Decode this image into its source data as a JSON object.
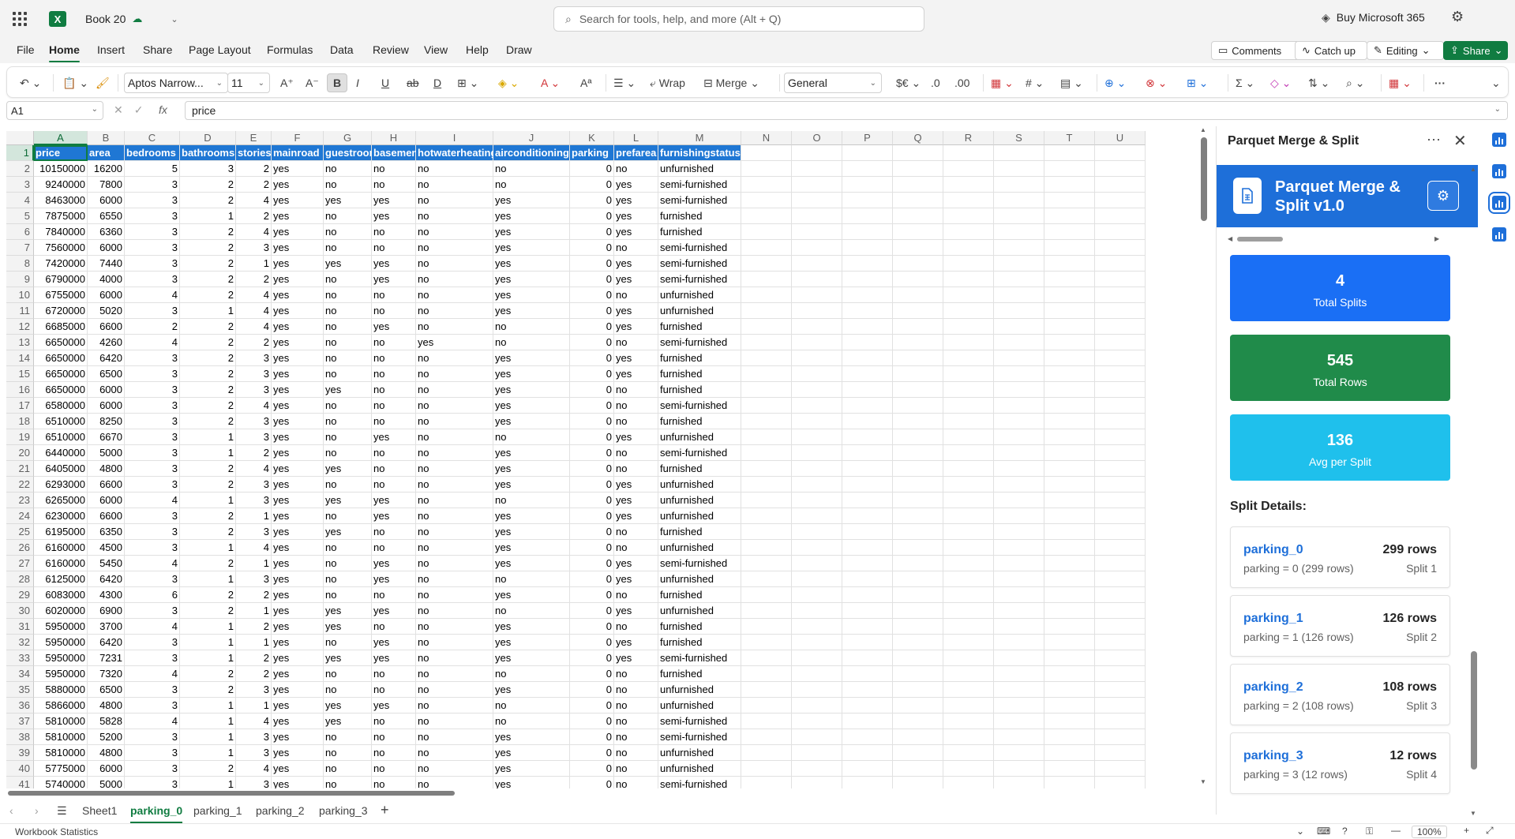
{
  "window": {
    "app_icon": "excel-logo",
    "doc_title": "Book 20",
    "search_placeholder": "Search for tools, help, and more (Alt + Q)",
    "buy": "Buy Microsoft 365"
  },
  "menus": [
    "File",
    "Home",
    "Insert",
    "Share",
    "Page Layout",
    "Formulas",
    "Data",
    "Review",
    "View",
    "Help",
    "Draw"
  ],
  "menu_active": "Home",
  "menu_buttons": {
    "comments": "Comments",
    "catchup": "Catch up",
    "editing": "Editing",
    "share": "Share"
  },
  "ribbon": {
    "font_name": "Aptos Narrow...",
    "font_size": "11",
    "wrap": "Wrap",
    "merge": "Merge",
    "number_format": "General"
  },
  "formula_bar": {
    "name_box": "A1",
    "fx": "fx",
    "content": "price"
  },
  "columns": [
    "A",
    "B",
    "C",
    "D",
    "E",
    "F",
    "G",
    "H",
    "I",
    "J",
    "K",
    "L",
    "M",
    "N",
    "O",
    "P",
    "Q",
    "R",
    "S",
    "T",
    "U"
  ],
  "header_row": [
    "price",
    "area",
    "bedrooms",
    "bathrooms",
    "stories",
    "mainroad",
    "guestroom",
    "basement",
    "hotwaterheating",
    "airconditioning",
    "parking",
    "prefarea",
    "furnishingstatus"
  ],
  "rows": [
    [
      "10150000",
      "16200",
      "5",
      "3",
      "2",
      "yes",
      "no",
      "no",
      "no",
      "no",
      "0",
      "no",
      "unfurnished"
    ],
    [
      "9240000",
      "7800",
      "3",
      "2",
      "2",
      "yes",
      "no",
      "no",
      "no",
      "no",
      "0",
      "yes",
      "semi-furnished"
    ],
    [
      "8463000",
      "6000",
      "3",
      "2",
      "4",
      "yes",
      "yes",
      "yes",
      "no",
      "yes",
      "0",
      "yes",
      "semi-furnished"
    ],
    [
      "7875000",
      "6550",
      "3",
      "1",
      "2",
      "yes",
      "no",
      "yes",
      "no",
      "yes",
      "0",
      "yes",
      "furnished"
    ],
    [
      "7840000",
      "6360",
      "3",
      "2",
      "4",
      "yes",
      "no",
      "no",
      "no",
      "yes",
      "0",
      "yes",
      "furnished"
    ],
    [
      "7560000",
      "6000",
      "3",
      "2",
      "3",
      "yes",
      "no",
      "no",
      "no",
      "yes",
      "0",
      "no",
      "semi-furnished"
    ],
    [
      "7420000",
      "7440",
      "3",
      "2",
      "1",
      "yes",
      "yes",
      "yes",
      "no",
      "yes",
      "0",
      "yes",
      "semi-furnished"
    ],
    [
      "6790000",
      "4000",
      "3",
      "2",
      "2",
      "yes",
      "no",
      "yes",
      "no",
      "yes",
      "0",
      "yes",
      "semi-furnished"
    ],
    [
      "6755000",
      "6000",
      "4",
      "2",
      "4",
      "yes",
      "no",
      "no",
      "no",
      "yes",
      "0",
      "no",
      "unfurnished"
    ],
    [
      "6720000",
      "5020",
      "3",
      "1",
      "4",
      "yes",
      "no",
      "no",
      "no",
      "yes",
      "0",
      "yes",
      "unfurnished"
    ],
    [
      "6685000",
      "6600",
      "2",
      "2",
      "4",
      "yes",
      "no",
      "yes",
      "no",
      "no",
      "0",
      "yes",
      "furnished"
    ],
    [
      "6650000",
      "4260",
      "4",
      "2",
      "2",
      "yes",
      "no",
      "no",
      "yes",
      "no",
      "0",
      "no",
      "semi-furnished"
    ],
    [
      "6650000",
      "6420",
      "3",
      "2",
      "3",
      "yes",
      "no",
      "no",
      "no",
      "yes",
      "0",
      "yes",
      "furnished"
    ],
    [
      "6650000",
      "6500",
      "3",
      "2",
      "3",
      "yes",
      "no",
      "no",
      "no",
      "yes",
      "0",
      "yes",
      "furnished"
    ],
    [
      "6650000",
      "6000",
      "3",
      "2",
      "3",
      "yes",
      "yes",
      "no",
      "no",
      "yes",
      "0",
      "no",
      "furnished"
    ],
    [
      "6580000",
      "6000",
      "3",
      "2",
      "4",
      "yes",
      "no",
      "no",
      "no",
      "yes",
      "0",
      "no",
      "semi-furnished"
    ],
    [
      "6510000",
      "8250",
      "3",
      "2",
      "3",
      "yes",
      "no",
      "no",
      "no",
      "yes",
      "0",
      "no",
      "furnished"
    ],
    [
      "6510000",
      "6670",
      "3",
      "1",
      "3",
      "yes",
      "no",
      "yes",
      "no",
      "no",
      "0",
      "yes",
      "unfurnished"
    ],
    [
      "6440000",
      "5000",
      "3",
      "1",
      "2",
      "yes",
      "no",
      "no",
      "no",
      "yes",
      "0",
      "no",
      "semi-furnished"
    ],
    [
      "6405000",
      "4800",
      "3",
      "2",
      "4",
      "yes",
      "yes",
      "no",
      "no",
      "yes",
      "0",
      "no",
      "furnished"
    ],
    [
      "6293000",
      "6600",
      "3",
      "2",
      "3",
      "yes",
      "no",
      "no",
      "no",
      "yes",
      "0",
      "yes",
      "unfurnished"
    ],
    [
      "6265000",
      "6000",
      "4",
      "1",
      "3",
      "yes",
      "yes",
      "yes",
      "no",
      "no",
      "0",
      "yes",
      "unfurnished"
    ],
    [
      "6230000",
      "6600",
      "3",
      "2",
      "1",
      "yes",
      "no",
      "yes",
      "no",
      "yes",
      "0",
      "yes",
      "unfurnished"
    ],
    [
      "6195000",
      "6350",
      "3",
      "2",
      "3",
      "yes",
      "yes",
      "no",
      "no",
      "yes",
      "0",
      "no",
      "furnished"
    ],
    [
      "6160000",
      "4500",
      "3",
      "1",
      "4",
      "yes",
      "no",
      "no",
      "no",
      "yes",
      "0",
      "no",
      "unfurnished"
    ],
    [
      "6160000",
      "5450",
      "4",
      "2",
      "1",
      "yes",
      "no",
      "yes",
      "no",
      "yes",
      "0",
      "yes",
      "semi-furnished"
    ],
    [
      "6125000",
      "6420",
      "3",
      "1",
      "3",
      "yes",
      "no",
      "yes",
      "no",
      "no",
      "0",
      "yes",
      "unfurnished"
    ],
    [
      "6083000",
      "4300",
      "6",
      "2",
      "2",
      "yes",
      "no",
      "no",
      "no",
      "yes",
      "0",
      "no",
      "furnished"
    ],
    [
      "6020000",
      "6900",
      "3",
      "2",
      "1",
      "yes",
      "yes",
      "yes",
      "no",
      "no",
      "0",
      "yes",
      "unfurnished"
    ],
    [
      "5950000",
      "3700",
      "4",
      "1",
      "2",
      "yes",
      "yes",
      "no",
      "no",
      "yes",
      "0",
      "no",
      "furnished"
    ],
    [
      "5950000",
      "6420",
      "3",
      "1",
      "1",
      "yes",
      "no",
      "yes",
      "no",
      "yes",
      "0",
      "yes",
      "furnished"
    ],
    [
      "5950000",
      "7231",
      "3",
      "1",
      "2",
      "yes",
      "yes",
      "yes",
      "no",
      "yes",
      "0",
      "yes",
      "semi-furnished"
    ],
    [
      "5950000",
      "7320",
      "4",
      "2",
      "2",
      "yes",
      "no",
      "no",
      "no",
      "no",
      "0",
      "no",
      "furnished"
    ],
    [
      "5880000",
      "6500",
      "3",
      "2",
      "3",
      "yes",
      "no",
      "no",
      "no",
      "yes",
      "0",
      "no",
      "unfurnished"
    ],
    [
      "5866000",
      "4800",
      "3",
      "1",
      "1",
      "yes",
      "yes",
      "yes",
      "no",
      "no",
      "0",
      "no",
      "unfurnished"
    ],
    [
      "5810000",
      "5828",
      "4",
      "1",
      "4",
      "yes",
      "yes",
      "no",
      "no",
      "no",
      "0",
      "no",
      "semi-furnished"
    ],
    [
      "5810000",
      "5200",
      "3",
      "1",
      "3",
      "yes",
      "no",
      "no",
      "no",
      "yes",
      "0",
      "no",
      "semi-furnished"
    ],
    [
      "5810000",
      "4800",
      "3",
      "1",
      "3",
      "yes",
      "no",
      "no",
      "no",
      "yes",
      "0",
      "no",
      "unfurnished"
    ],
    [
      "5775000",
      "6000",
      "3",
      "2",
      "4",
      "yes",
      "no",
      "no",
      "no",
      "yes",
      "0",
      "no",
      "unfurnished"
    ],
    [
      "5740000",
      "5000",
      "3",
      "1",
      "3",
      "yes",
      "no",
      "no",
      "no",
      "yes",
      "0",
      "no",
      "semi-furnished"
    ]
  ],
  "sheet_tabs": [
    "Sheet1",
    "parking_0",
    "parking_1",
    "parking_2",
    "parking_3"
  ],
  "sheet_active": "parking_0",
  "status": {
    "left": "Workbook Statistics",
    "zoom": "100%"
  },
  "panel": {
    "title": "Parquet Merge & Split",
    "app_title": "Parquet Merge & Split v1.0",
    "stats": [
      {
        "value": "4",
        "label": "Total Splits",
        "color": "#1a6ff5"
      },
      {
        "value": "545",
        "label": "Total Rows",
        "color": "#208b4a"
      },
      {
        "value": "136",
        "label": "Avg per Split",
        "color": "#1fc0ec"
      }
    ],
    "split_details_title": "Split Details:",
    "splits": [
      {
        "name": "parking_0",
        "rows": "299 rows",
        "cond": "parking = 0 (299 rows)",
        "index": "Split 1"
      },
      {
        "name": "parking_1",
        "rows": "126 rows",
        "cond": "parking = 1 (126 rows)",
        "index": "Split 2"
      },
      {
        "name": "parking_2",
        "rows": "108 rows",
        "cond": "parking = 2 (108 rows)",
        "index": "Split 3"
      },
      {
        "name": "parking_3",
        "rows": "12 rows",
        "cond": "parking = 3 (12 rows)",
        "index": "Split 4"
      }
    ]
  }
}
